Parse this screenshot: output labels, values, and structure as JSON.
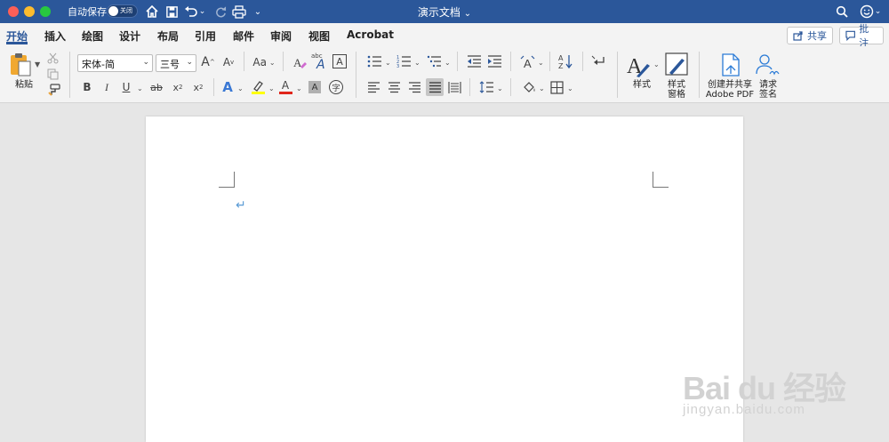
{
  "titlebar": {
    "autosave_label": "自动保存",
    "autosave_state": "关闭",
    "doc_title": "演示文档",
    "doc_title_caret": "⌄"
  },
  "tabs": [
    "开始",
    "插入",
    "绘图",
    "设计",
    "布局",
    "引用",
    "邮件",
    "审阅",
    "视图",
    "Acrobat"
  ],
  "active_tab": "开始",
  "share_label": "共享",
  "comment_label": "批注",
  "clipboard": {
    "paste_label": "粘贴"
  },
  "font": {
    "family": "宋体-简",
    "size": "三号"
  },
  "font_buttons": {
    "grow": "A",
    "shrink": "A",
    "case": "Aa",
    "bold": "B",
    "italic": "I",
    "underline": "U",
    "strike": "ab",
    "subscript": "x",
    "superscript": "x",
    "text_effect": "A",
    "font_color": "A",
    "char_shade": "A",
    "phonetic": "abc",
    "char_border": "A",
    "enclose": "字"
  },
  "styles": {
    "styles_label": "样式",
    "pane_label_line1": "样式",
    "pane_label_line2": "窗格"
  },
  "adobe": {
    "create_line1": "创建并共享",
    "create_line2": "Adobe PDF",
    "sign_line1": "请求",
    "sign_line2": "签名"
  },
  "document": {
    "paragraph_mark": "↵"
  },
  "watermark": {
    "main": "Bai du 经验",
    "sub": "jingyan.baidu.com"
  },
  "colors": {
    "titlebar": "#2b579a",
    "accent": "#2b579a",
    "highlight": "#ffff00",
    "font_color": "#e0261b"
  }
}
